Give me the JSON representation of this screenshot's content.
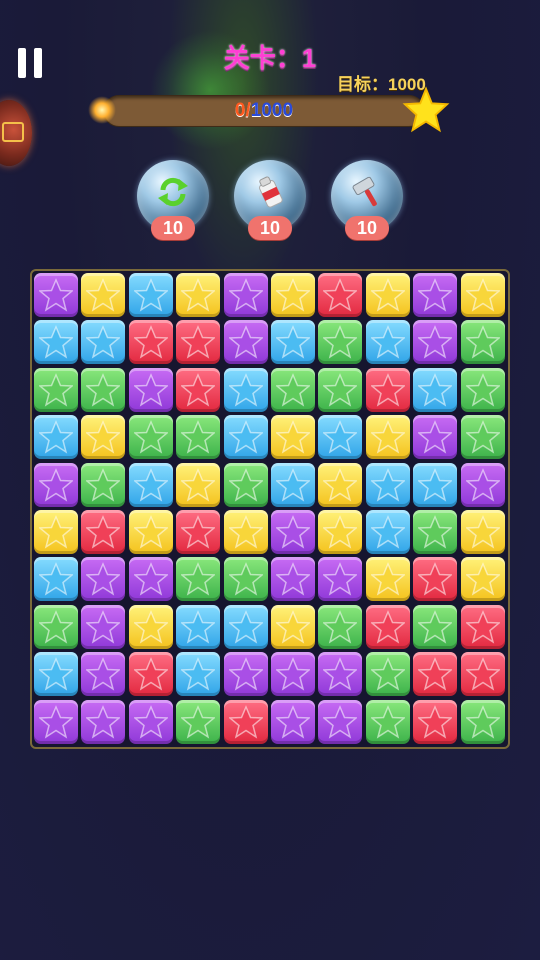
{
  "hud": {
    "level_label": "关卡：1",
    "target_label": "目标：1000",
    "score_current": "0",
    "score_sep": "/",
    "score_total": "1000",
    "progress_fraction": 0
  },
  "boosters": [
    {
      "name": "refresh",
      "icon": "refresh-icon",
      "count": "10"
    },
    {
      "name": "pop",
      "icon": "pop-bottle-icon",
      "count": "10"
    },
    {
      "name": "hammer",
      "icon": "hammer-icon",
      "count": "10"
    }
  ],
  "colors": {
    "purple": "#a94fe6",
    "yellow": "#f8d63a",
    "blue": "#4bbcf2",
    "red": "#f04058",
    "green": "#5fcb5c"
  },
  "board": {
    "rows": 10,
    "cols": 10,
    "grid": [
      [
        "purple",
        "yellow",
        "blue",
        "yellow",
        "purple",
        "yellow",
        "red",
        "yellow",
        "purple",
        "yellow"
      ],
      [
        "blue",
        "blue",
        "red",
        "red",
        "purple",
        "blue",
        "green",
        "blue",
        "purple",
        "green"
      ],
      [
        "green",
        "green",
        "purple",
        "red",
        "blue",
        "green",
        "green",
        "red",
        "blue",
        "green"
      ],
      [
        "blue",
        "yellow",
        "green",
        "green",
        "blue",
        "yellow",
        "blue",
        "yellow",
        "purple",
        "green"
      ],
      [
        "purple",
        "green",
        "blue",
        "yellow",
        "green",
        "blue",
        "yellow",
        "blue",
        "blue",
        "purple"
      ],
      [
        "yellow",
        "red",
        "yellow",
        "red",
        "yellow",
        "purple",
        "yellow",
        "blue",
        "green",
        "yellow"
      ],
      [
        "blue",
        "purple",
        "purple",
        "green",
        "green",
        "purple",
        "purple",
        "yellow",
        "red",
        "yellow"
      ],
      [
        "green",
        "purple",
        "yellow",
        "blue",
        "blue",
        "yellow",
        "green",
        "red",
        "green",
        "red"
      ],
      [
        "blue",
        "purple",
        "red",
        "blue",
        "purple",
        "purple",
        "purple",
        "green",
        "red",
        "red"
      ],
      [
        "purple",
        "purple",
        "purple",
        "green",
        "red",
        "purple",
        "purple",
        "green",
        "red",
        "green"
      ]
    ]
  }
}
